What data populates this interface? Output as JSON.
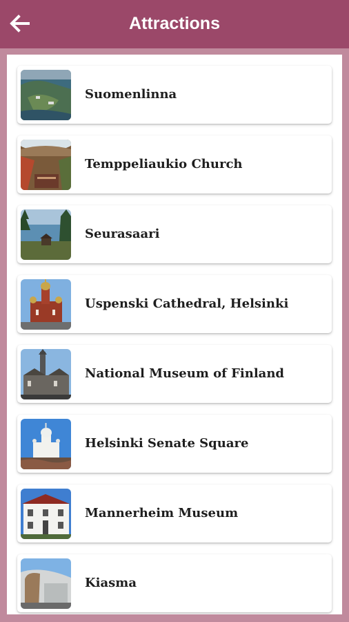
{
  "app_bar": {
    "title": "Attractions",
    "back_icon": "arrow-left-icon",
    "color": "#9b4869"
  },
  "attractions": [
    {
      "name": "Suomenlinna"
    },
    {
      "name": "Temppeliaukio Church"
    },
    {
      "name": "Seurasaari"
    },
    {
      "name": "Uspenski Cathedral, Helsinki"
    },
    {
      "name": "National Museum of Finland"
    },
    {
      "name": "Helsinki Senate Square"
    },
    {
      "name": "Mannerheim Museum"
    },
    {
      "name": "Kiasma"
    }
  ]
}
